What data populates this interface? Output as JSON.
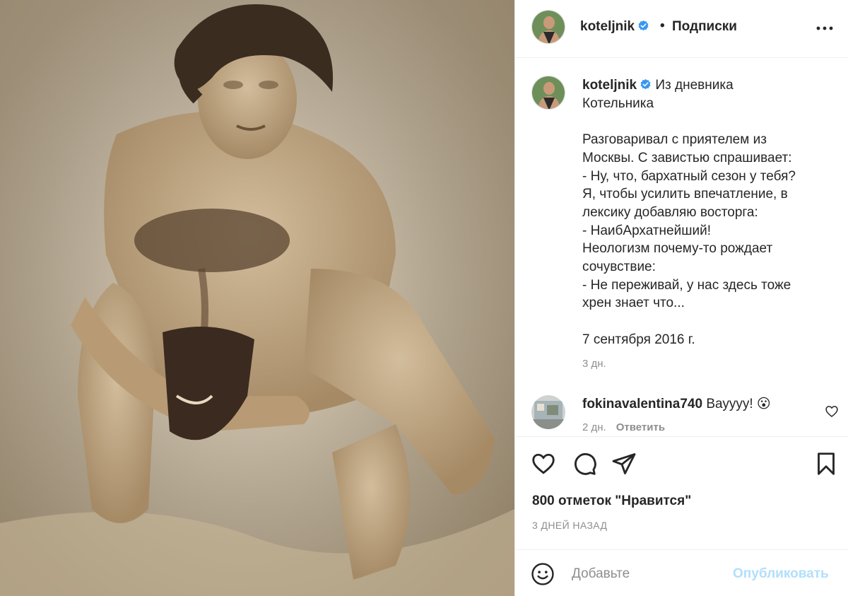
{
  "post": {
    "author": "koteljnik",
    "header_separator": "•",
    "follow_label": "Подписки",
    "more_icon": "more-horizontal-icon"
  },
  "caption": {
    "username": "koteljnik",
    "lines": [
      "Из дневника",
      "Котельника",
      "",
      "Разговаривал с приятелем из",
      "Москвы. С завистью спрашивает:",
      "- Ну, что, бархатный сезон у тебя?",
      "Я, чтобы усилить впечатление, в",
      "лексику добавляю восторга:",
      "- НаибАрхатнейший!",
      "Неологизм почему-то рождает",
      "сочувствие:",
      "- Не переживай, у нас здесь тоже",
      "хрен знает что...",
      "",
      "7 сентября 2016 г."
    ],
    "time": "3 дн."
  },
  "comment": {
    "username": "fokinavalentina740",
    "text": "Вауууу! 😮",
    "time": "2 дн.",
    "reply_label": "Ответить"
  },
  "actions": {
    "likes_text": "800 отметок \"Нравится\"",
    "posted_ago": "3 ДНЕЙ НАЗАД"
  },
  "add_comment": {
    "placeholder": "Добавьте",
    "publish_label": "Опубликовать"
  },
  "colors": {
    "verified": "#3897f0",
    "publish_disabled": "#b2dffc",
    "secondary_text": "#8e8e8e"
  }
}
